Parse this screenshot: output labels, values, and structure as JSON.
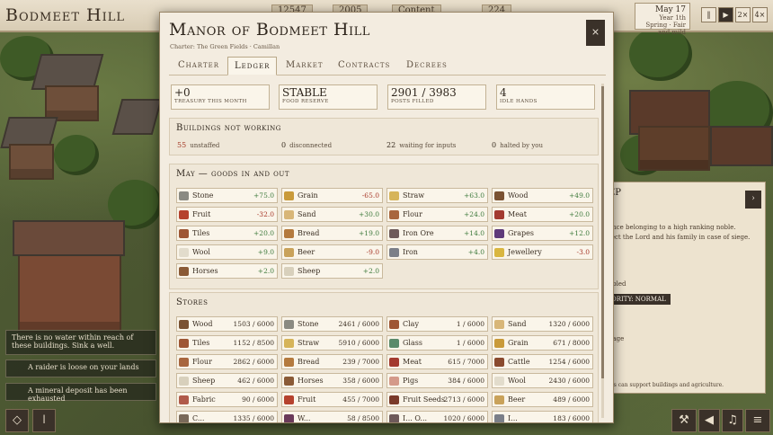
{
  "topbar": {
    "town": "Bodmeet Hill",
    "stats": [
      "12547",
      "2005",
      "Content",
      "224"
    ],
    "date": {
      "day": "May 17",
      "line2": "Year 1th",
      "line3": "Spring · Fair and mild"
    },
    "speed": [
      "‖",
      "▶",
      "2×",
      "4×"
    ]
  },
  "notices": [
    "There is no water within reach of these buildings. Sink a well.",
    "A raider is loose on your lands",
    "A mineral deposit has been exhausted"
  ],
  "sidepanel": {
    "title": "EP",
    "lines": [
      "ance belonging to a high ranking noble.",
      "tect the Lord and his family in case of siege.",
      "s",
      "abled",
      "ORITY: NORMAL",
      "nage",
      "uls can support buildings and agriculture."
    ]
  },
  "modal": {
    "title": "Manor of Bodmeet Hill",
    "charter": "Charter: The Green Fields · Camillan",
    "close": "×",
    "tabs": [
      {
        "label": "Charter"
      },
      {
        "label": "Ledger"
      },
      {
        "label": "Market"
      },
      {
        "label": "Contracts"
      },
      {
        "label": "Decrees"
      }
    ],
    "summary": [
      {
        "value": "+0",
        "label": "Treasury this month"
      },
      {
        "value": "STABLE",
        "label": "Food reserve"
      },
      {
        "value": "2901 / 3983",
        "label": "Posts filled"
      },
      {
        "value": "4",
        "label": "Idle hands"
      }
    ],
    "bnw": {
      "title": "Buildings not working",
      "items": [
        {
          "count": "55",
          "label": "unstaffed"
        },
        {
          "count": "0",
          "label": "disconnected"
        },
        {
          "count": "22",
          "label": "waiting for inputs"
        },
        {
          "count": "0",
          "label": "halted by you"
        }
      ]
    },
    "flow": {
      "title": "May — goods in and out",
      "items": [
        {
          "name": "Stone",
          "value": "+75.0",
          "color": "#8a8a82",
          "icon": "stone-icon"
        },
        {
          "name": "Grain",
          "value": "-65.0",
          "color": "#c99a3a",
          "icon": "grain-icon"
        },
        {
          "name": "Straw",
          "value": "+63.0",
          "color": "#d6b45a",
          "icon": "straw-icon"
        },
        {
          "name": "Wood",
          "value": "+49.0",
          "color": "#7a5232",
          "icon": "wood-icon"
        },
        {
          "name": "Fruit",
          "value": "-32.0",
          "color": "#b5422e",
          "icon": "fruit-icon"
        },
        {
          "name": "Sand",
          "value": "+30.0",
          "color": "#d8b678",
          "icon": "sand-icon"
        },
        {
          "name": "Flour",
          "value": "+24.0",
          "color": "#a8663e",
          "icon": "flour-icon"
        },
        {
          "name": "Meat",
          "value": "+20.0",
          "color": "#a33a30",
          "icon": "meat-icon"
        },
        {
          "name": "Tiles",
          "value": "+20.0",
          "color": "#9e5634",
          "icon": "tiles-icon"
        },
        {
          "name": "Bread",
          "value": "+19.0",
          "color": "#b47a3e",
          "icon": "bread-icon"
        },
        {
          "name": "Iron Ore",
          "value": "+14.0",
          "color": "#6e5a5a",
          "icon": "iron-ore-icon"
        },
        {
          "name": "Grapes",
          "value": "+12.0",
          "color": "#5e3a7a",
          "icon": "grapes-icon"
        },
        {
          "name": "Wool",
          "value": "+9.0",
          "color": "#e2dccc",
          "icon": "wool-icon"
        },
        {
          "name": "Beer",
          "value": "-9.0",
          "color": "#c9a25a",
          "icon": "beer-icon"
        },
        {
          "name": "Iron",
          "value": "+4.0",
          "color": "#7b7f88",
          "icon": "iron-icon"
        },
        {
          "name": "Jewellery",
          "value": "-3.0",
          "color": "#d9b640",
          "icon": "jewellery-icon"
        },
        {
          "name": "Horses",
          "value": "+2.0",
          "color": "#8a5a36",
          "icon": "horses-icon"
        },
        {
          "name": "Sheep",
          "value": "+2.0",
          "color": "#d8d0bc",
          "icon": "sheep-icon"
        }
      ]
    },
    "stores": {
      "title": "Stores",
      "items": [
        {
          "name": "Wood",
          "value": "1503 / 6000",
          "color": "#7a5232",
          "icon": "wood-icon"
        },
        {
          "name": "Stone",
          "value": "2461 / 6000",
          "color": "#8a8a82",
          "icon": "stone-icon"
        },
        {
          "name": "Clay",
          "value": "1 / 6000",
          "color": "#9e5634",
          "icon": "clay-icon"
        },
        {
          "name": "Sand",
          "value": "1320 / 6000",
          "color": "#d8b678",
          "icon": "sand-icon"
        },
        {
          "name": "Tiles",
          "value": "1152 / 8500",
          "color": "#9e5634",
          "icon": "tiles-icon"
        },
        {
          "name": "Straw",
          "value": "5910 / 6000",
          "color": "#d6b45a",
          "icon": "straw-icon"
        },
        {
          "name": "Glass",
          "value": "1 / 6000",
          "color": "#5a8a6a",
          "icon": "glass-icon"
        },
        {
          "name": "Grain",
          "value": "671 / 8000",
          "color": "#c99a3a",
          "icon": "grain-icon"
        },
        {
          "name": "Flour",
          "value": "2862 / 6000",
          "color": "#a8663e",
          "icon": "flour-icon"
        },
        {
          "name": "Bread",
          "value": "239 / 7000",
          "color": "#b47a3e",
          "icon": "bread-icon"
        },
        {
          "name": "Meat",
          "value": "615 / 7000",
          "color": "#a33a30",
          "icon": "meat-icon"
        },
        {
          "name": "Cattle",
          "value": "1254 / 6000",
          "color": "#8a4a2e",
          "icon": "cattle-icon"
        },
        {
          "name": "Sheep",
          "value": "462 / 6000",
          "color": "#d8d0bc",
          "icon": "sheep-icon"
        },
        {
          "name": "Horses",
          "value": "358 / 6000",
          "color": "#8a5a36",
          "icon": "horses-icon"
        },
        {
          "name": "Pigs",
          "value": "384 / 6000",
          "color": "#d49a8a",
          "icon": "pigs-icon"
        },
        {
          "name": "Wool",
          "value": "2430 / 6000",
          "color": "#e2dccc",
          "icon": "wool-icon"
        },
        {
          "name": "Fabric",
          "value": "90 / 6000",
          "color": "#b05a4a",
          "icon": "fabric-icon"
        },
        {
          "name": "Fruit",
          "value": "455 / 7000",
          "color": "#b5422e",
          "icon": "fruit-icon"
        },
        {
          "name": "Fruit Seeds",
          "value": "2713 / 6000",
          "color": "#7a3a2a",
          "icon": "fruit-seeds-icon"
        },
        {
          "name": "Beer",
          "value": "489 / 6000",
          "color": "#c9a25a",
          "icon": "beer-icon"
        },
        {
          "name": "C...",
          "value": "1335 / 6000",
          "color": "#7a6a5a",
          "icon": "goods-icon"
        },
        {
          "name": "W...",
          "value": "58 / 8500",
          "color": "#6a3a5a",
          "icon": "goods-icon"
        },
        {
          "name": "I... O...",
          "value": "1020 / 6000",
          "color": "#6e5a5a",
          "icon": "goods-icon"
        },
        {
          "name": "I...",
          "value": "183 / 6000",
          "color": "#7b7f88",
          "icon": "goods-icon"
        }
      ]
    }
  }
}
